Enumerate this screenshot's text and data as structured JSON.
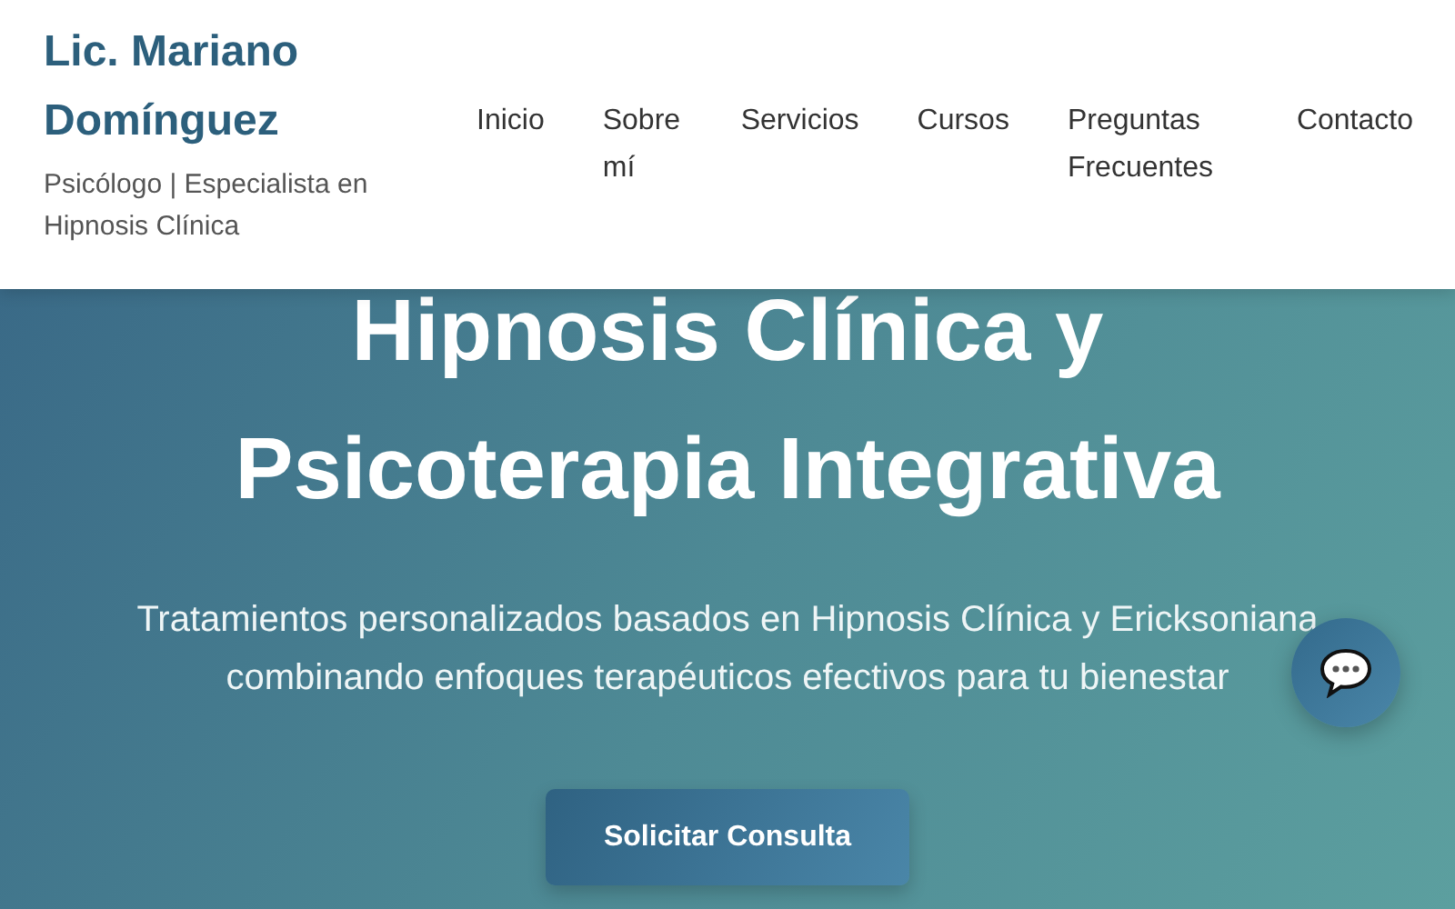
{
  "brand": {
    "name": "Lic. Mariano Domínguez",
    "tagline": "Psicólogo | Especialista en Hipnosis Clínica"
  },
  "nav": [
    {
      "label": "Inicio"
    },
    {
      "label": "Sobre mí"
    },
    {
      "label": "Servicios"
    },
    {
      "label": "Cursos"
    },
    {
      "label": "Preguntas Frecuentes"
    },
    {
      "label": "Contacto"
    }
  ],
  "hero": {
    "title_lines": [
      "Hipnosis Clínica y",
      "Psicoterapia Integrativa"
    ],
    "subtitle": "Tratamientos personalizados basados en Hipnosis Clínica y Ericksoniana combinando enfoques terapéuticos efectivos para tu bienestar",
    "button": "Solicitar Consulta"
  }
}
